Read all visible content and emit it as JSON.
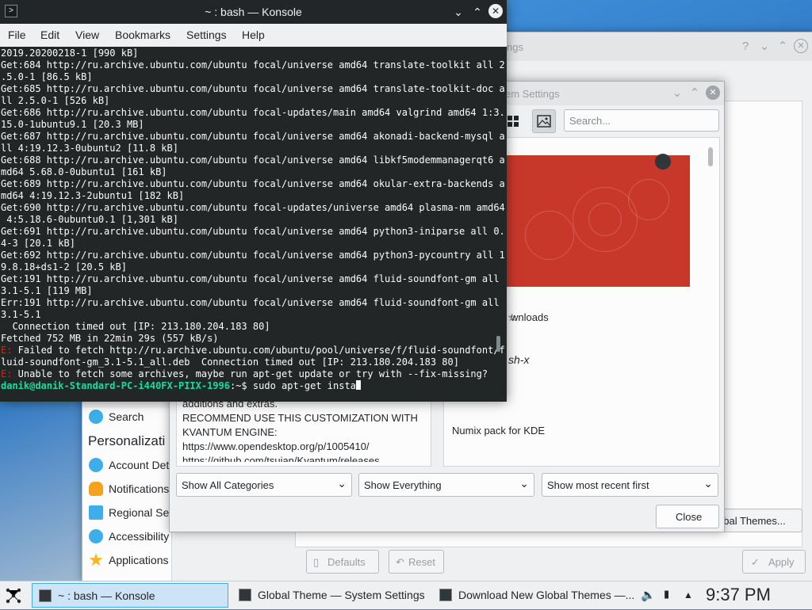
{
  "system_settings": {
    "title_partial": "ngs",
    "sidebar_search": "Search",
    "personalization_heading": "Personalizati",
    "sidebar_items": [
      "Account Deta",
      "Notifications",
      "Regional Sett",
      "Accessibility",
      "Applications"
    ],
    "buttons": {
      "global_themes": "obal Themes...",
      "defaults": "Defaults",
      "reset": "Reset",
      "apply": "Apply"
    }
  },
  "download_dialog": {
    "title_partial": "em Settings",
    "search_placeholder": "Search...",
    "description_lines": [
      "additions and extras.",
      "RECOMMEND USE THIS CUSTOMIZATION WITH",
      "KVANTUM ENGINE:",
      "https://www.opendesktop.org/p/1005410/",
      "https://github.com/tsujan/Kvantum/releases"
    ],
    "right_list": {
      "downloads_partial": "wnloads",
      "name_partial": "sh-x",
      "item_title": "Numix pack for KDE"
    },
    "filters": {
      "categories": "Show All Categories",
      "status": "Show Everything",
      "sort": "Show most recent first"
    },
    "close_label": "Close"
  },
  "konsole": {
    "title": "~ : bash — Konsole",
    "menu": [
      "File",
      "Edit",
      "View",
      "Bookmarks",
      "Settings",
      "Help"
    ],
    "lines": [
      {
        "text": "2019.20200218-1 [990 kB]"
      },
      {
        "text": "Get:684 http://ru.archive.ubuntu.com/ubuntu focal/universe amd64 translate-toolkit all 2"
      },
      {
        "text": ".5.0-1 [86.5 kB]"
      },
      {
        "text": "Get:685 http://ru.archive.ubuntu.com/ubuntu focal/universe amd64 translate-toolkit-doc a"
      },
      {
        "text": "ll 2.5.0-1 [526 kB]"
      },
      {
        "text": "Get:686 http://ru.archive.ubuntu.com/ubuntu focal-updates/main amd64 valgrind amd64 1:3."
      },
      {
        "text": "15.0-1ubuntu9.1 [20.3 MB]"
      },
      {
        "text": "Get:687 http://ru.archive.ubuntu.com/ubuntu focal/universe amd64 akonadi-backend-mysql a"
      },
      {
        "text": "ll 4:19.12.3-0ubuntu2 [11.8 kB]"
      },
      {
        "text": "Get:688 http://ru.archive.ubuntu.com/ubuntu focal/universe amd64 libkf5modemmanagerqt6 a"
      },
      {
        "text": "md64 5.68.0-0ubuntu1 [161 kB]"
      },
      {
        "text": "Get:689 http://ru.archive.ubuntu.com/ubuntu focal/universe amd64 okular-extra-backends a"
      },
      {
        "text": "md64 4:19.12.3-2ubuntu1 [182 kB]"
      },
      {
        "text": "Get:690 http://ru.archive.ubuntu.com/ubuntu focal-updates/universe amd64 plasma-nm amd64"
      },
      {
        "text": " 4:5.18.6-0ubuntu0.1 [1,301 kB]"
      },
      {
        "text": "Get:691 http://ru.archive.ubuntu.com/ubuntu focal/universe amd64 python3-iniparse all 0."
      },
      {
        "text": "4-3 [20.1 kB]"
      },
      {
        "text": "Get:692 http://ru.archive.ubuntu.com/ubuntu focal/universe amd64 python3-pycountry all 1"
      },
      {
        "text": "9.8.18+ds1-2 [20.5 kB]"
      },
      {
        "text": "Get:191 http://ru.archive.ubuntu.com/ubuntu focal/universe amd64 fluid-soundfont-gm all"
      },
      {
        "text": "3.1-5.1 [119 MB]"
      },
      {
        "text": "Err:191 http://ru.archive.ubuntu.com/ubuntu focal/universe amd64 fluid-soundfont-gm all"
      },
      {
        "text": "3.1-5.1"
      },
      {
        "text": "  Connection timed out [IP: 213.180.204.183 80]"
      },
      {
        "text": "Fetched 752 MB in 22min 29s (557 kB/s)"
      },
      {
        "prefix": "E:",
        "text": " Failed to fetch http://ru.archive.ubuntu.com/ubuntu/pool/universe/f/fluid-soundfont/f"
      },
      {
        "text": "luid-soundfont-gm_3.1-5.1_all.deb  Connection timed out [IP: 213.180.204.183 80]"
      },
      {
        "prefix": "E:",
        "text": " Unable to fetch some archives, maybe run apt-get update or try with --fix-missing?"
      }
    ],
    "prompt": "danik@danik-Standard-PC-i440FX-PIIX-1996",
    "prompt_suffix": ":~$ ",
    "command": "sudo apt-get insta"
  },
  "taskbar": {
    "tasks": [
      "~ : bash — Konsole",
      "Global Theme  — System Settings",
      "Download New Global Themes —..."
    ],
    "clock": "9:37 PM"
  },
  "colors": {
    "terminal_bg": "#232627",
    "prompt": "#1cdc9a",
    "error": "#ed1515",
    "accent": "#3daee9",
    "theme_preview": "#c8382a"
  }
}
